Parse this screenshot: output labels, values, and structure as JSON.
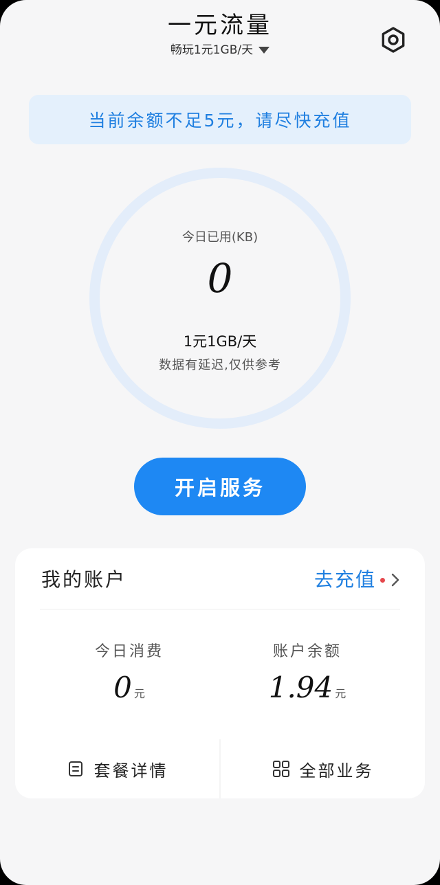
{
  "header": {
    "title": "一元流量",
    "plan_selector": "畅玩1元1GB/天"
  },
  "notice": {
    "text": "当前余额不足5元，请尽快充值"
  },
  "usage": {
    "label": "今日已用(KB)",
    "value": "0",
    "rate": "1元1GB/天",
    "note": "数据有延迟,仅供参考"
  },
  "start_button": {
    "label": "开启服务"
  },
  "account": {
    "title": "我的账户",
    "recharge_label": "去充值",
    "today_spend": {
      "label": "今日消费",
      "value": "0",
      "unit": "元"
    },
    "balance": {
      "label": "账户余额",
      "value": "1.94",
      "unit": "元"
    },
    "actions": {
      "package_details": "套餐详情",
      "all_services": "全部业务"
    }
  },
  "icons": {
    "settings": "gear-icon",
    "dropdown": "caret-down-icon",
    "chevron": "chevron-right-icon",
    "package": "document-icon",
    "services": "grid-icon"
  },
  "colors": {
    "accent": "#1e88f3",
    "link": "#1f7fe0",
    "notice_bg": "#e4f0fc",
    "ring": "#e3edfa",
    "badge": "#e5484d"
  }
}
